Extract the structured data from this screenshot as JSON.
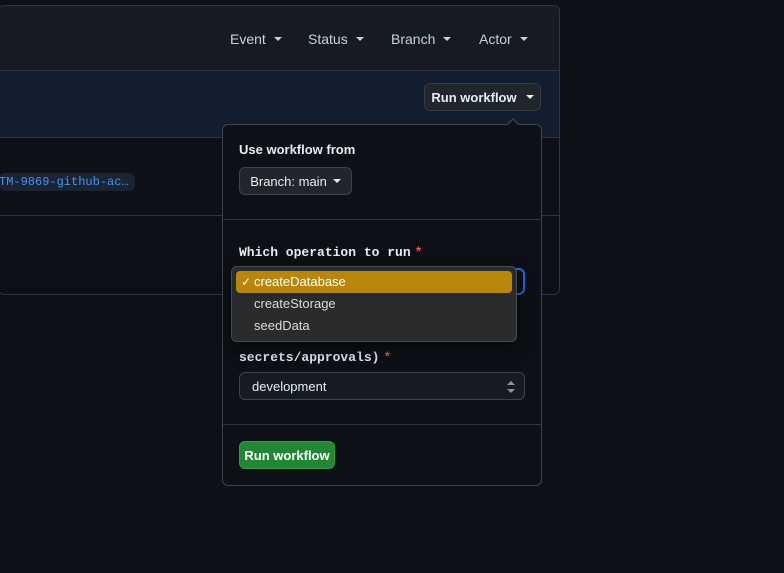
{
  "filters": [
    "Event",
    "Status",
    "Branch",
    "Actor"
  ],
  "run_workflow_button": "Run workflow",
  "branch_chip": "TM-9869-github-ac…",
  "popover": {
    "use_workflow_from_label": "Use workflow from",
    "branch_button": "Branch: main",
    "operation_label": "Which operation to run",
    "required_marker": "*",
    "env_label_tail": "secrets/approvals)",
    "env_value": "development",
    "submit_button": "Run workflow"
  },
  "operation_dropdown": {
    "options": [
      "createDatabase",
      "createStorage",
      "seedData"
    ],
    "selected": "createDatabase",
    "check_glyph": "✓"
  },
  "colors": {
    "selected_option": "#b8860b",
    "submit": "#238636",
    "required": "#f85149",
    "link": "#4493f8"
  }
}
